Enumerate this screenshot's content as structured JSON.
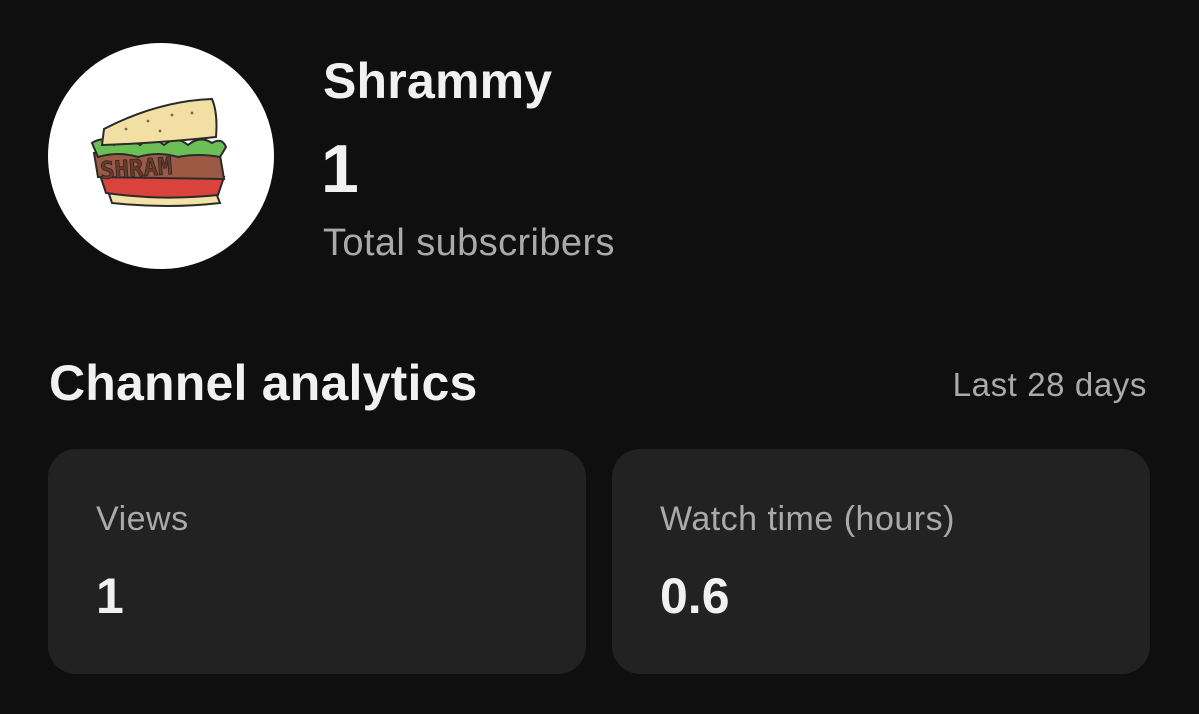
{
  "channel": {
    "name": "Shrammy",
    "subscriber_count": "1",
    "subscriber_label": "Total subscribers",
    "avatar": {
      "icon": "sandwich-logo",
      "lettering": "SHRAM"
    }
  },
  "analytics": {
    "title": "Channel analytics",
    "range": "Last 28 days",
    "cards": [
      {
        "label": "Views",
        "value": "1"
      },
      {
        "label": "Watch time (hours)",
        "value": "0.6"
      }
    ]
  },
  "colors": {
    "background": "#0f0f0f",
    "card": "#222222",
    "primary_text": "#f1f1f1",
    "secondary_text": "#aaaaaa"
  }
}
